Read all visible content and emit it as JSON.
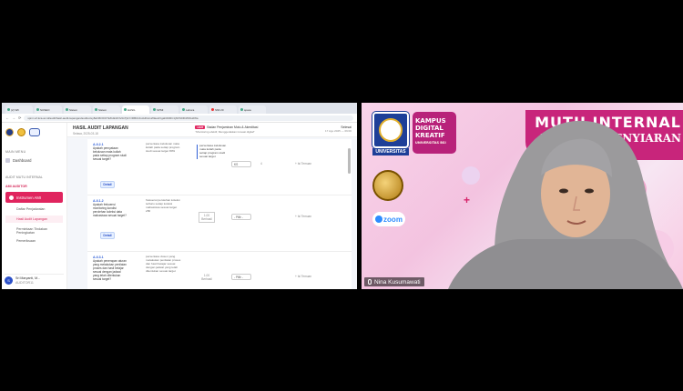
{
  "browser": {
    "tabs": [
      {
        "label": "(2) Wh",
        "active": false
      },
      {
        "label": "SUSEO",
        "active": false
      },
      {
        "label": "Sistem",
        "active": false
      },
      {
        "label": "Sistem",
        "active": false
      },
      {
        "label": "HASIL",
        "active": true
      },
      {
        "label": "SPMI",
        "active": false
      },
      {
        "label": "Labora",
        "active": false
      },
      {
        "label": "SMI 20",
        "active": false
      },
      {
        "label": "space",
        "active": false
      }
    ],
    "url": "spmi-v2.kca.ac.id/audit/hasil-audit-lapangan/auditor/ey8ahI6ODIzTkZIdk4zNVdvTjlsYzRBUUtvcHFHm2hEeHVgaDZ4RC1jNXhDRnl5OHdWa",
    "nav_back": "←",
    "nav_fwd": "→",
    "nav_reload": "⟳"
  },
  "sidebar": {
    "main_menu": "MAIN MENU",
    "dashboard": "Dashboard",
    "audit_header": "AUDIT MUTU INTERNAL",
    "role": "AMI AUDITOR",
    "active_item": "Instrumen AMI",
    "subs": [
      {
        "label": "Daftar Penjadwalan",
        "selected": false
      },
      {
        "label": "Hasil Audit Lapangan",
        "selected": true
      },
      {
        "label": "Permintaan Tindakan Peningkatan",
        "selected": false
      },
      {
        "label": "Pemeriksaan",
        "selected": false
      }
    ],
    "user_name": "Sri Maryanti, M...",
    "user_id": "AUDITOR11"
  },
  "page": {
    "title": "HASIL AUDIT LAPANGAN",
    "date": "Selasa, 2025-03-18",
    "unit_tag": "UNIT",
    "unit": "Badan Penjaminan Mutu & Akreditasi",
    "unit_sub": "\"Monitoring efektif, Menggerakkan inovasi digital\"",
    "status": "Selesai",
    "status_time": "17 Agu 2025 — 09:00"
  },
  "rows": [
    {
      "code": "A.II.2.1",
      "question": "Apakah pernyataan kelulusan mata kuliah pada setiap program studi sesuai target?",
      "answer": "persentase kelulusan mata kuliah pada setiap program studi sesuai target 80%",
      "answer2": "persentase kelulusan mata kuliah pada setiap program studi sesuai target",
      "select": "KS",
      "score": "4",
      "detail": "Detail",
      "link": "+ Isi Temuan"
    },
    {
      "code": "A.II.1.2",
      "question": "Apakah frekuensi monitoring kondisi perolehan koleksi data mahasiswa sesuai target?",
      "answer": "frekuensi perolehan koleksi terbaru setiap koleksi mahasiswa sesuai target ≥50",
      "answer2": "",
      "select": "- Pilih -",
      "score": "1.00 Berhasil",
      "detail": "Detail",
      "link": "+ Isi Temuan"
    },
    {
      "code": "A.II.3.1",
      "question": "Apakah penerapan aturan yang melakukan penilaian proses dan hasil belajar sesuai dengan jadwal yang telah ditentukan sesuai target?",
      "answer": "persentase dosen yang melakukan penilaian proses dan hasil belajar sesuai dengan jadwal yang telah ditentukan sesuai target",
      "answer2": "",
      "select": "- Pilih -",
      "score": "1.00 Berhasil",
      "detail": "Detail",
      "link": "+ Isi Temuan"
    }
  ],
  "camera": {
    "banner_line1": "MUTU INTERNAL",
    "banner_line2": "AM STUDI PENYIARAN",
    "campus_logo_l1": "KAMPUS",
    "campus_logo_l2": "DIGITAL",
    "campus_logo_l3": "KREATIF",
    "campus_logo_sub": "UNIVERSITAS BSI",
    "uni_label": "UNIVERSITAS",
    "zoom": "zoom",
    "participant_name": "Nina Kusumawati"
  }
}
